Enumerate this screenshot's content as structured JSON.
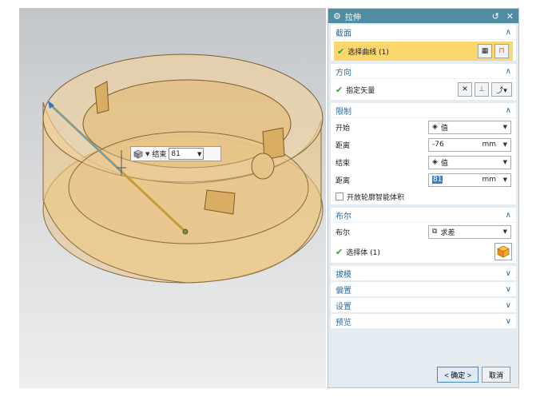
{
  "dialog": {
    "title": "拉伸",
    "reset_glyph": "↺",
    "close_glyph": "✕"
  },
  "section_profile": {
    "header": "截面",
    "select_curve": "选择曲线 (1)"
  },
  "section_direction": {
    "header": "方向",
    "specify_vector": "指定矢量"
  },
  "section_limits": {
    "header": "限制",
    "start_label": "开始",
    "start_option": "值",
    "start_distance_label": "距离",
    "start_distance_value": "-76",
    "start_unit": "mm",
    "end_label": "结束",
    "end_option": "值",
    "end_distance_label": "距离",
    "end_distance_value": "81",
    "end_unit": "mm",
    "open_profile_label": "开放轮廓智能体积"
  },
  "section_boolean": {
    "header": "布尔",
    "boolean_label": "布尔",
    "boolean_option": "求差",
    "select_body": "选择体 (1)"
  },
  "collapsed_sections": {
    "draft": "拔模",
    "offset": "偏置",
    "settings": "设置",
    "preview": "预览"
  },
  "footer": {
    "ok": "< 确定 >",
    "cancel": "取消"
  },
  "floating_input": {
    "label": "结束",
    "value": "81"
  },
  "icons": {
    "gear": "gear-icon",
    "check": "check-icon",
    "cube": "cube-icon"
  },
  "colors": {
    "title_bar": "#4f8da3",
    "highlight": "#fcd76d",
    "section_header": "#2a6ea3",
    "model": "#f2c980"
  }
}
